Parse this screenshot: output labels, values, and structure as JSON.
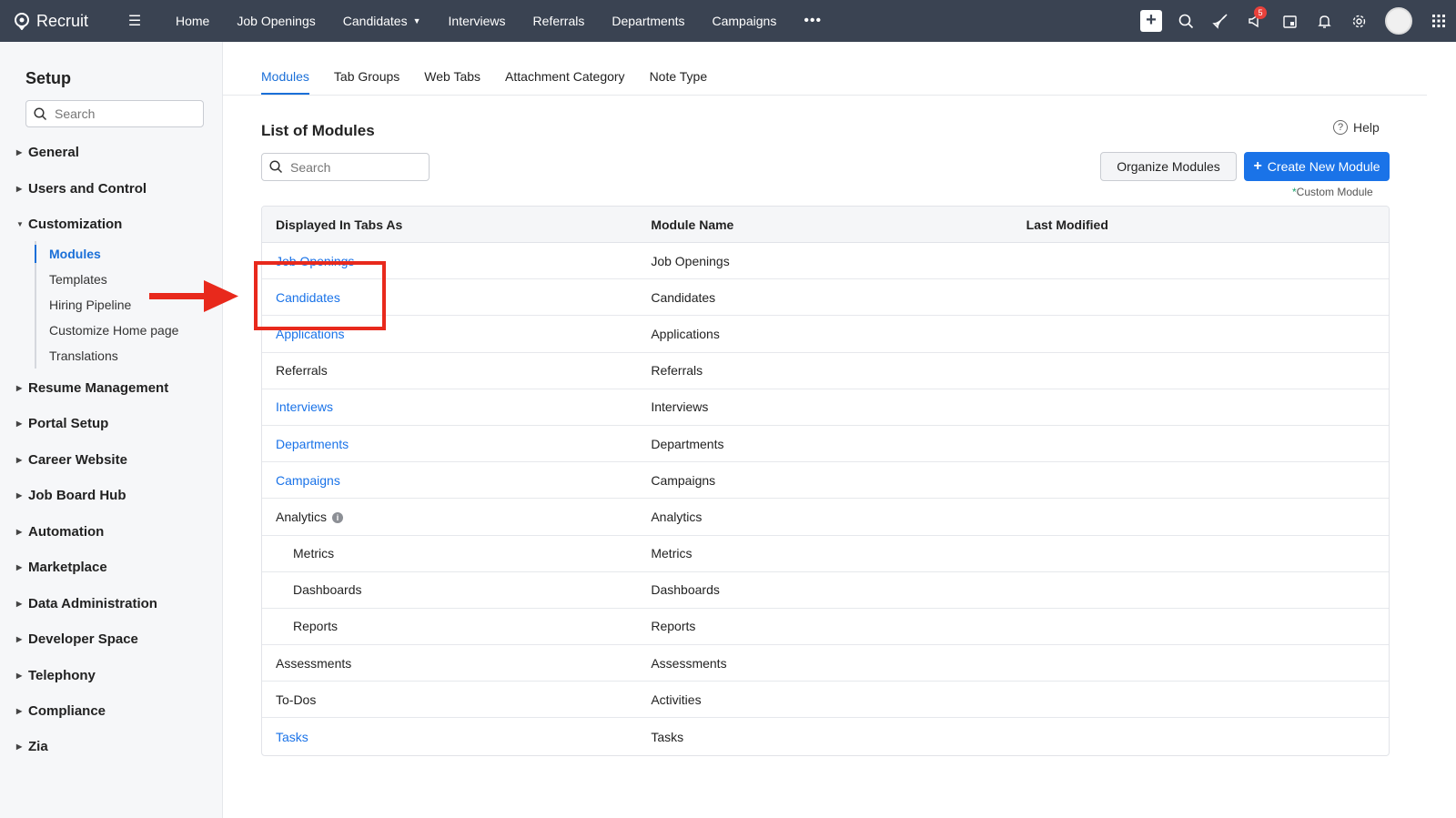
{
  "app": {
    "brand": "Recruit",
    "nav": [
      "Home",
      "Job Openings",
      "Candidates",
      "Interviews",
      "Referrals",
      "Departments",
      "Campaigns"
    ],
    "notification_count": "5"
  },
  "sidebar": {
    "title": "Setup",
    "search_placeholder": "Search",
    "sections": [
      "General",
      "Users and Control",
      "Customization",
      "Resume Management",
      "Portal Setup",
      "Career Website",
      "Job Board Hub",
      "Automation",
      "Marketplace",
      "Data Administration",
      "Developer Space",
      "Telephony",
      "Compliance",
      "Zia"
    ],
    "customization_items": [
      "Modules",
      "Templates",
      "Hiring Pipeline",
      "Customize Home page",
      "Translations"
    ]
  },
  "tabs": [
    "Modules",
    "Tab Groups",
    "Web Tabs",
    "Attachment Category",
    "Note Type"
  ],
  "main": {
    "title": "List of Modules",
    "help_label": "Help",
    "search_placeholder": "Search",
    "organize_label": "Organize Modules",
    "create_label": "Create New Module",
    "custom_note": "Custom Module"
  },
  "table": {
    "columns": [
      "Displayed In Tabs As",
      "Module Name",
      "Last Modified"
    ],
    "rows": [
      {
        "tab": "Job Openings",
        "module": "Job Openings",
        "link": true
      },
      {
        "tab": "Candidates",
        "module": "Candidates",
        "link": true
      },
      {
        "tab": "Applications",
        "module": "Applications",
        "link": true
      },
      {
        "tab": "Referrals",
        "module": "Referrals",
        "link": false
      },
      {
        "tab": "Interviews",
        "module": "Interviews",
        "link": true
      },
      {
        "tab": "Departments",
        "module": "Departments",
        "link": true
      },
      {
        "tab": "Campaigns",
        "module": "Campaigns",
        "link": true
      },
      {
        "tab": "Analytics",
        "module": "Analytics",
        "link": false,
        "info": true
      },
      {
        "tab": "Metrics",
        "module": "Metrics",
        "link": false,
        "indent": true
      },
      {
        "tab": "Dashboards",
        "module": "Dashboards",
        "link": false,
        "indent": true
      },
      {
        "tab": "Reports",
        "module": "Reports",
        "link": false,
        "indent": true
      },
      {
        "tab": "Assessments",
        "module": "Assessments",
        "link": false
      },
      {
        "tab": "To-Dos",
        "module": "Activities",
        "link": false
      },
      {
        "tab": "Tasks",
        "module": "Tasks",
        "link": true
      }
    ]
  },
  "colors": {
    "topbar": "#3a4352",
    "link": "#1a73e8",
    "annotation": "#e8291c"
  }
}
